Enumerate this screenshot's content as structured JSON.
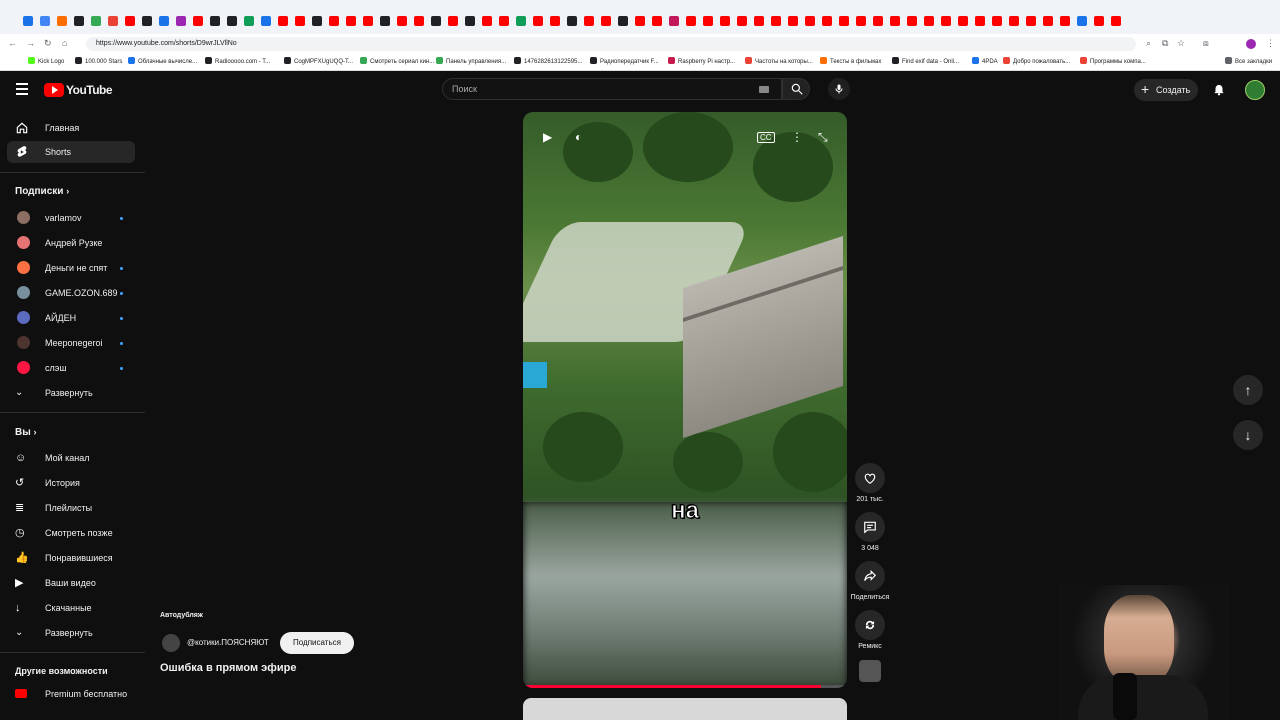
{
  "browser": {
    "url": "https://www.youtube.com/shorts/D9wrJLVllNo",
    "tab_colors": [
      "#1a73e8",
      "#4285f4",
      "#ff6d00",
      "#202124",
      "#34a853",
      "#ea4335",
      "#ff0000",
      "#202124",
      "#1a73e8",
      "#9c27b0",
      "#ff0000",
      "#202124",
      "#202124",
      "#0f9d58",
      "#1a73e8",
      "#ff0000",
      "#ff0000",
      "#202124",
      "#ff0000",
      "#ff0000",
      "#ff0000",
      "#202124",
      "#ff0000",
      "#ff0000",
      "#202124",
      "#ff0000",
      "#202124",
      "#ff0000",
      "#ff0000",
      "#0f9d58",
      "#ff0000",
      "#ff0000",
      "#202124",
      "#ff0000",
      "#ff0000",
      "#202124",
      "#ff0000",
      "#ff0000",
      "#c2185b",
      "#ff0000",
      "#ff0000",
      "#ff0000",
      "#ff0000",
      "#ff0000",
      "#ff0000",
      "#ff0000",
      "#ff0000",
      "#ff0000",
      "#ff0000",
      "#ff0000",
      "#ff0000",
      "#ff0000",
      "#ff0000",
      "#ff0000",
      "#ff0000",
      "#ff0000",
      "#ff0000",
      "#ff0000",
      "#ff0000",
      "#ff0000",
      "#ff0000",
      "#ff0000",
      "#1a73e8",
      "#ff0000",
      "#ff0000"
    ],
    "bookmarks": [
      {
        "label": "Kick Logo",
        "color": "#53fc18"
      },
      {
        "label": "100.000 Stars",
        "color": "#202124"
      },
      {
        "label": "Облачные вычисле...",
        "color": "#1a73e8"
      },
      {
        "label": "Radiooooo.com - T...",
        "color": "#202124"
      },
      {
        "label": "CogMPFXUgUQQ-T...",
        "color": "#202124"
      },
      {
        "label": "Смотреть сериал кин...",
        "color": "#34a853"
      },
      {
        "label": "Панель управления...",
        "color": "#34a853"
      },
      {
        "label": "1476282613122595...",
        "color": "#202124"
      },
      {
        "label": "Радиопередатчик F...",
        "color": "#202124"
      },
      {
        "label": "Raspberry Pi настр...",
        "color": "#c51a4a"
      },
      {
        "label": "Частоты на которы...",
        "color": "#ea4335"
      },
      {
        "label": "Тексты в фильмах",
        "color": "#ff6d00"
      },
      {
        "label": "Find exif data - Onli...",
        "color": "#202124"
      },
      {
        "label": "4PDA",
        "color": "#1a73e8"
      },
      {
        "label": "Добро пожаловать...",
        "color": "#ea4335"
      },
      {
        "label": "Программы компа...",
        "color": "#ea4335"
      },
      {
        "label": "Все закладки",
        "color": "#5f6368"
      }
    ]
  },
  "header": {
    "logo_text": "YouTube",
    "search_placeholder": "Поиск",
    "create_label": "Создать"
  },
  "sidebar": {
    "main": [
      {
        "label": "Главная",
        "icon": "home-icon"
      },
      {
        "label": "Shorts",
        "icon": "shorts-icon",
        "active": true
      }
    ],
    "subs_header": "Подписки",
    "subs": [
      {
        "label": "varlamov",
        "color": "#8d6e63",
        "dot": true
      },
      {
        "label": "Андрей Рузке",
        "color": "#e57373",
        "dot": false
      },
      {
        "label": "Деньги не спят",
        "color": "#ff7043",
        "dot": true
      },
      {
        "label": "GAME.OZON.689",
        "color": "#78909c",
        "dot": true
      },
      {
        "label": "АЙДЕН",
        "color": "#5c6bc0",
        "dot": true
      },
      {
        "label": "Meeponegeroi",
        "color": "#4e342e",
        "dot": true
      },
      {
        "label": "слэш",
        "color": "#ff1744",
        "dot": true
      }
    ],
    "subs_expand": "Развернуть",
    "you_header": "Вы",
    "you": [
      {
        "label": "Мой канал",
        "icon": "channel-icon"
      },
      {
        "label": "История",
        "icon": "history-icon"
      },
      {
        "label": "Плейлисты",
        "icon": "playlists-icon"
      },
      {
        "label": "Смотреть позже",
        "icon": "watch-later-icon"
      },
      {
        "label": "Понравившиеся",
        "icon": "like-icon"
      },
      {
        "label": "Ваши видео",
        "icon": "your-videos-icon"
      },
      {
        "label": "Скачанные",
        "icon": "downloads-icon"
      }
    ],
    "you_expand": "Развернуть",
    "more_header": "Другие возможности",
    "premium": "Premium бесплатно"
  },
  "short": {
    "caption": "на",
    "progress": 0.92,
    "autodub": "Автодубляж",
    "channel": "@котики.ПОЯСНЯЮТ",
    "subscribe": "Подписаться",
    "title": "Ошибка в прямом эфире"
  },
  "actions": {
    "likes": "201 тыс.",
    "comments": "3 048",
    "share": "Поделиться",
    "remix": "Ремикс"
  }
}
